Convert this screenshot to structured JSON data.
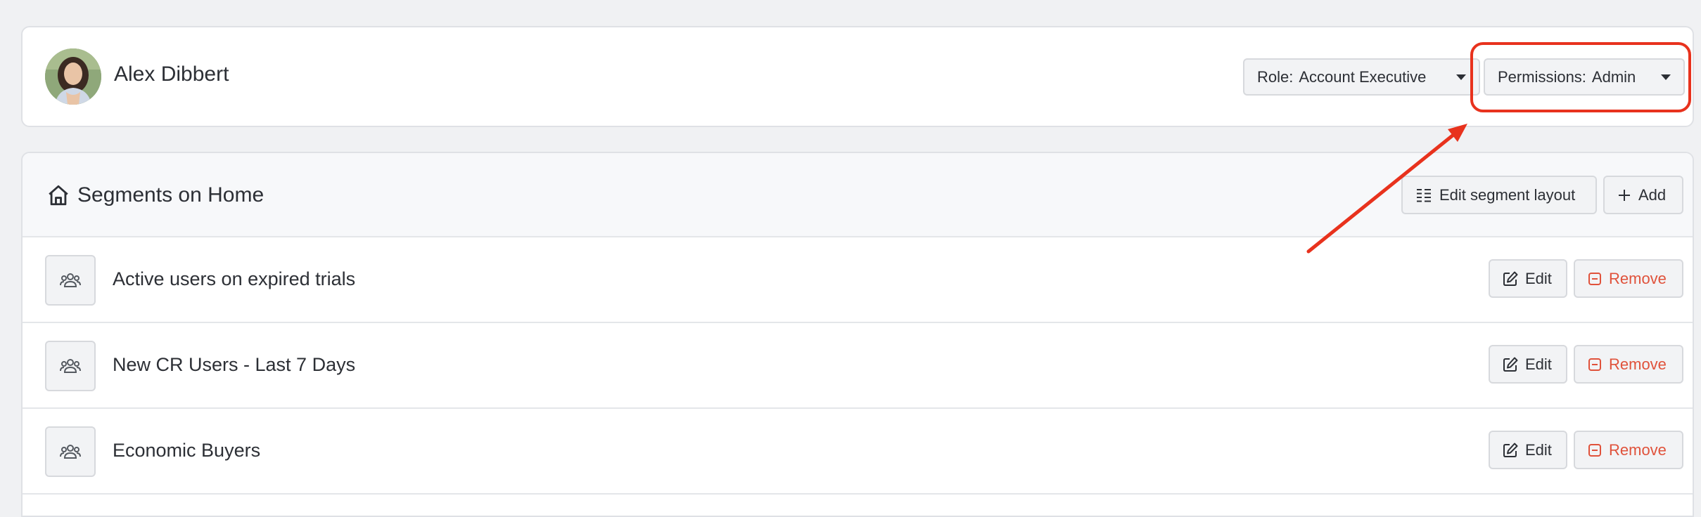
{
  "user": {
    "name": "Alex Dibbert",
    "role_label": "Role:",
    "role_value": "Account Executive",
    "permissions_label": "Permissions:",
    "permissions_value": "Admin"
  },
  "segments": {
    "title": "Segments on Home",
    "edit_layout_label": "Edit segment layout",
    "add_label": "Add",
    "rows": [
      {
        "label": "Active users on expired trials",
        "edit": "Edit",
        "remove": "Remove"
      },
      {
        "label": "New CR Users - Last 7 Days",
        "edit": "Edit",
        "remove": "Remove"
      },
      {
        "label": "Economic Buyers",
        "edit": "Edit",
        "remove": "Remove"
      }
    ]
  },
  "annotation": {
    "color": "#e8321d",
    "target": "permissions-dropdown"
  },
  "colors": {
    "remove_text": "#e0523b",
    "background": "#f0f1f3"
  },
  "icons": [
    "user-avatar",
    "home-icon",
    "layout-list-icon",
    "plus-icon",
    "users-group-icon",
    "edit-icon",
    "remove-icon",
    "caret-down-icon"
  ]
}
